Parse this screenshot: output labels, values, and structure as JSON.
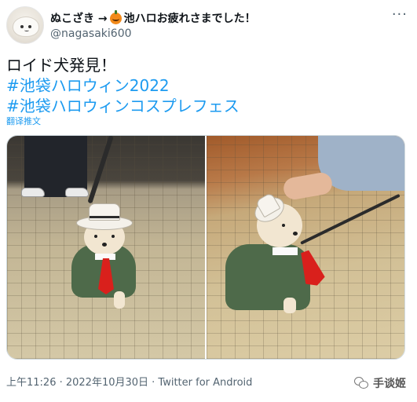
{
  "author": {
    "display_name_prefix": "ぬこざき →",
    "pumpkin_emoji": "jack-o-lantern-icon",
    "display_name_suffix": "池ハロお疲れさまでした！",
    "handle": "@nagasaki600"
  },
  "more_menu": {
    "label": "···"
  },
  "tweet": {
    "text_line1": "ロイド犬発見！",
    "hashtag1": "#池袋ハロウィン2022",
    "hashtag2": "#池袋ハロウィンコスプレフェス",
    "translate_label": "翻译推文"
  },
  "media": {
    "photos": [
      {
        "name": "photo-1",
        "subject": "dog in green suit with white hat and red tie on a leash"
      },
      {
        "name": "photo-2",
        "subject": "dog in green suit being petted"
      }
    ]
  },
  "meta": {
    "timestamp": "上午11:26 · 2022年10月30日 · Twitter for Android"
  },
  "watermark": {
    "label": "手谈姬"
  },
  "colors": {
    "link": "#1d9bf0",
    "text": "#0f1419",
    "secondary": "#536471"
  }
}
